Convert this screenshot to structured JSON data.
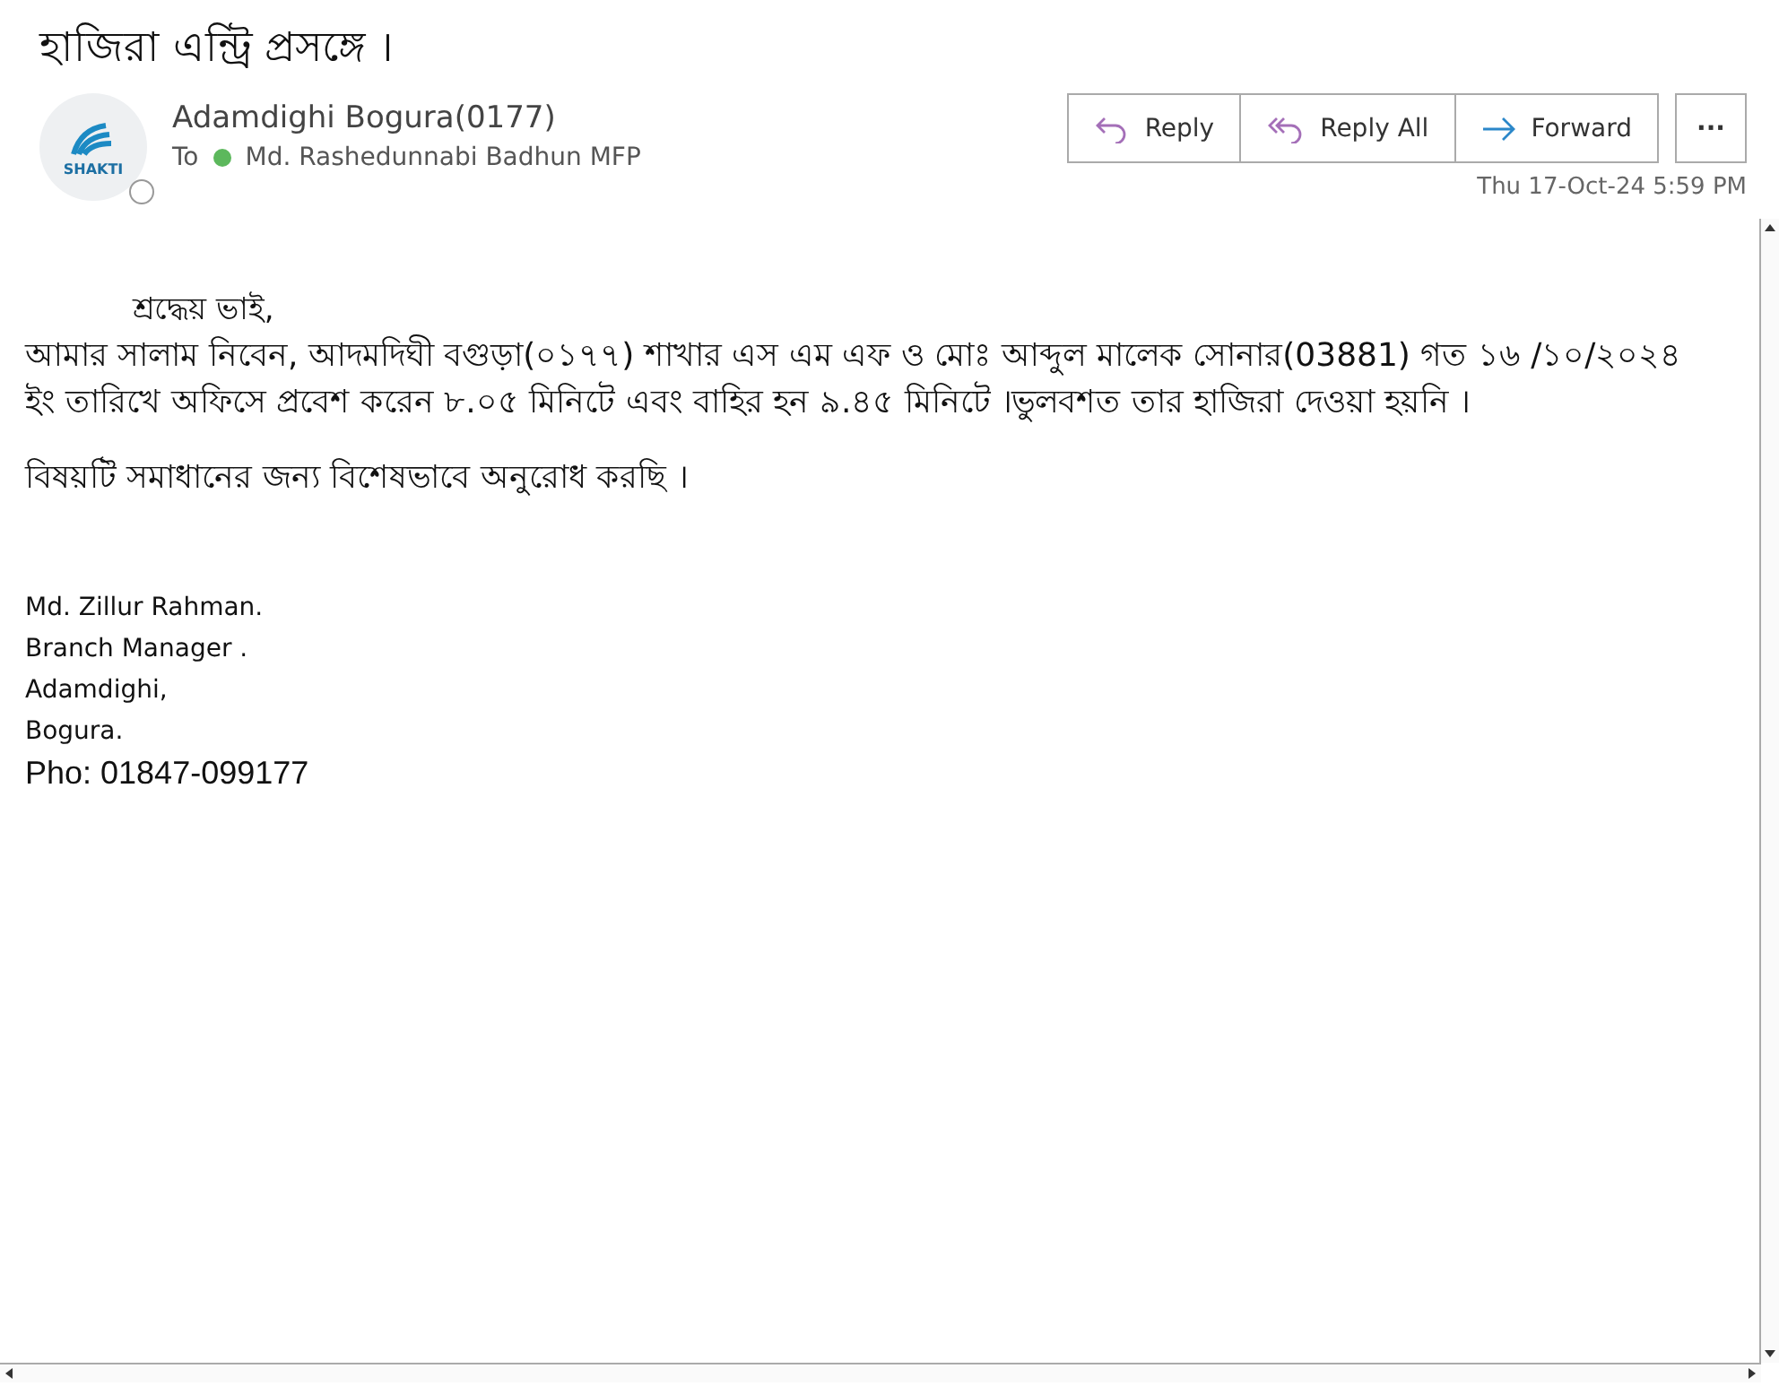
{
  "subject": "হাজিরা এন্ট্রি প্রসঙ্গে ।",
  "sender": {
    "name": "Adamdighi Bogura(0177)",
    "avatar_text": "SHAKTI",
    "to_label": "To",
    "recipient": "Md. Rashedunnabi Badhun MFP",
    "recipient_available": true
  },
  "actions": [
    {
      "kind": "reply",
      "label": "Reply"
    },
    {
      "kind": "reply_all",
      "label": "Reply All"
    },
    {
      "kind": "forward",
      "label": "Forward"
    },
    {
      "kind": "more",
      "label": "···"
    }
  ],
  "date": "Thu 17-Oct-24 5:59 PM",
  "body": {
    "greeting": "শ্রদ্ধেয় ভাই,",
    "paragraphs": [
      "আমার সালাম নিবেন, আদমদিঘী বগুড়া(০১৭৭) শাখার  এস এম এফ ও মোঃ আব্দুল মালেক সোনার(03881) গত ১৬ /১০/২০২৪ ইং তারিখে অফিসে প্রবেশ করেন ৮.০৫ মিনিটে এবং বাহির হন ৯.৪৫ মিনিটে ।ভুলবশত তার হাজিরা দেওয়া হয়নি ।",
      "বিষয়টি সমাধানের জন্য বিশেষভাবে অনুরোধ করছি ।"
    ],
    "signature": [
      "Md. Zillur Rahman.",
      "Branch Manager .",
      "Adamdighi,",
      "Bogura."
    ],
    "phone": "Pho: 01847-099177"
  }
}
